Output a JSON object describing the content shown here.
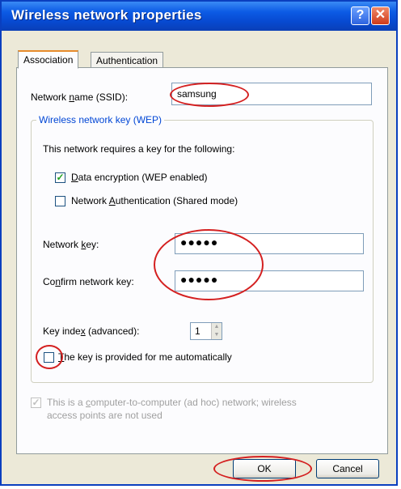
{
  "dialog": {
    "title": "Wireless network properties",
    "help_label": "?",
    "close_label": "✕"
  },
  "tabs": [
    {
      "label": "Association",
      "active": true
    },
    {
      "label": "Authentication",
      "active": false
    }
  ],
  "association": {
    "ssid_label_pre": "Network ",
    "ssid_label_u": "n",
    "ssid_label_post": "ame (SSID):",
    "ssid_value": "samsung",
    "wep_group_label": "Wireless network key (WEP)",
    "requires_key_text": "This network requires a key for the following:",
    "data_encryption": {
      "pre": "",
      "u": "D",
      "post": "ata encryption (WEP enabled)",
      "checked": true
    },
    "network_auth": {
      "pre": "Network ",
      "u": "A",
      "post": "uthentication (Shared mode)",
      "checked": false
    },
    "network_key": {
      "pre": "Network ",
      "u": "k",
      "post": "ey:",
      "value": "●●●●●"
    },
    "confirm_key": {
      "pre": "Co",
      "u": "n",
      "post": "firm network key:",
      "value": "●●●●●"
    },
    "key_index": {
      "pre": "Key inde",
      "u": "x",
      "post": " (advanced):",
      "value": "1"
    },
    "auto_key": {
      "pre": "",
      "u": "T",
      "post": "he key is provided for me automatically",
      "checked": false
    },
    "adhoc": {
      "line1_pre": "This is a ",
      "line1_u": "c",
      "line1_post": "omputer-to-computer (ad hoc) network; wireless",
      "line2": "access points are not used",
      "checked": true,
      "disabled": true
    }
  },
  "buttons": {
    "ok": "OK",
    "cancel": "Cancel"
  },
  "annotation_color": "#d42020",
  "check_glyph": "✓",
  "spin_up": "▲",
  "spin_down": "▼"
}
